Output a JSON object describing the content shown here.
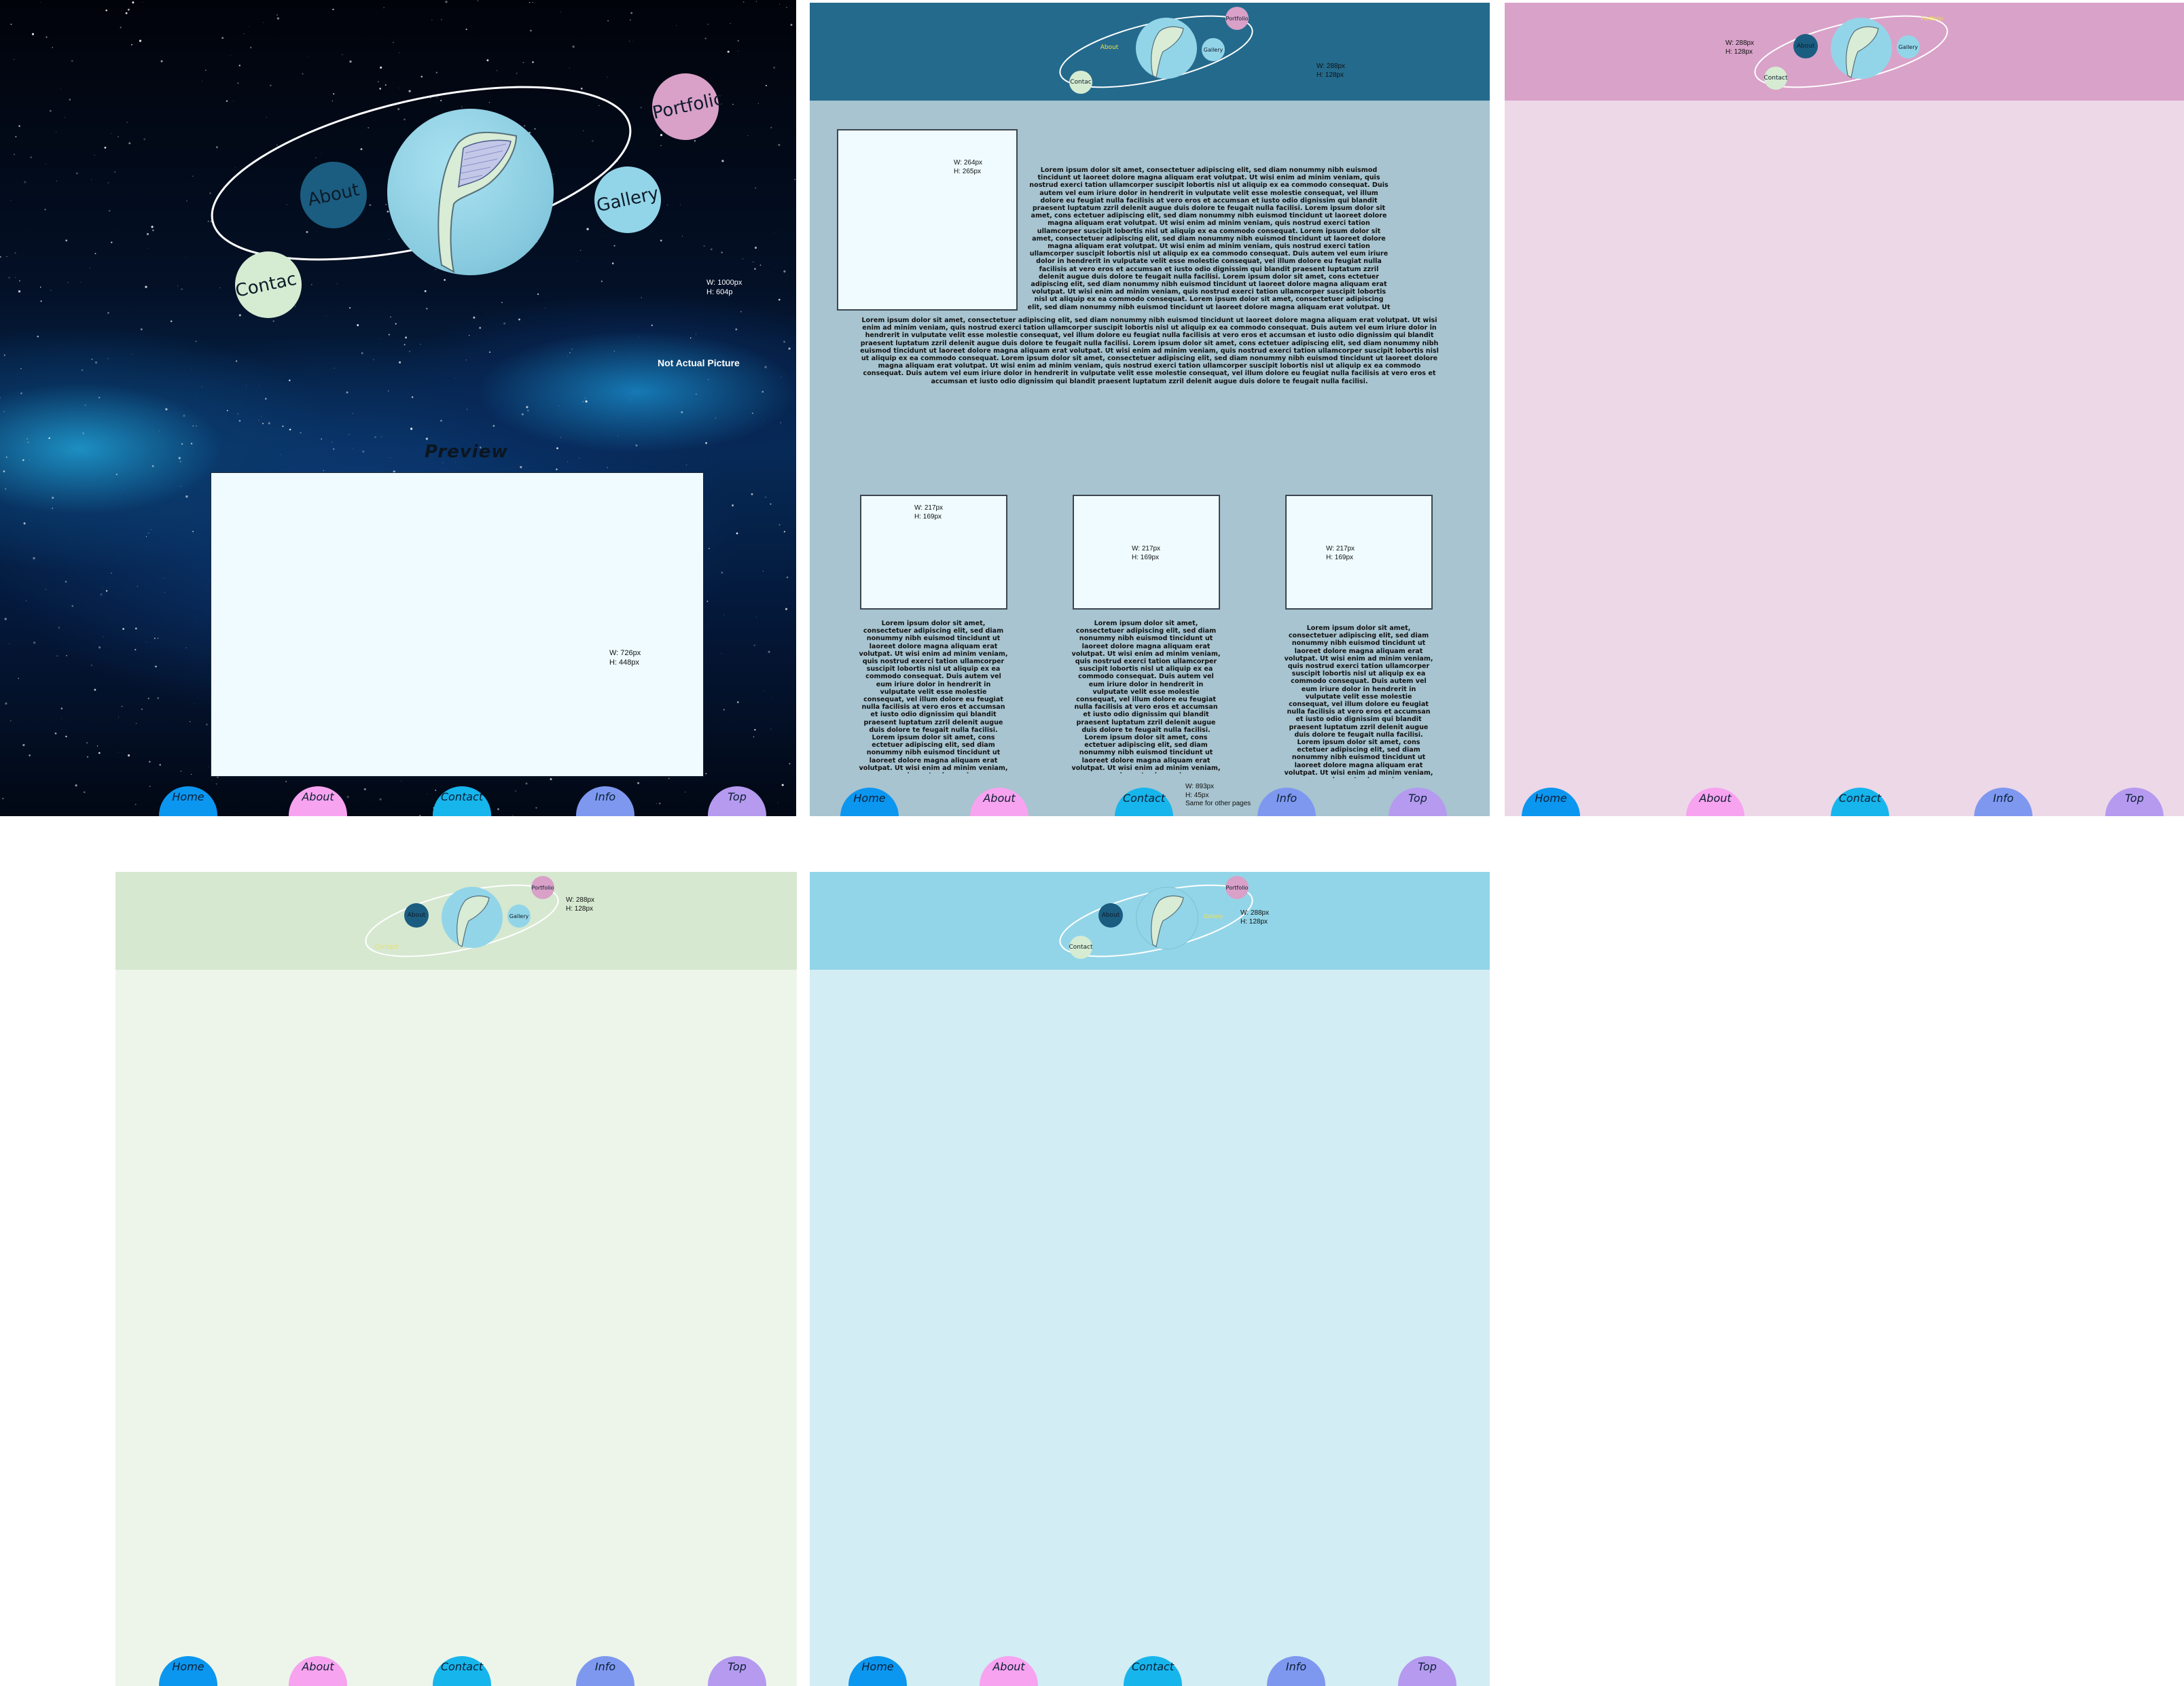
{
  "logo_labels": {
    "about": "About",
    "contact": "Contact",
    "contact_cut": "Contac",
    "portfolio": "Portfolio",
    "portfolio_cut": "Portfolic",
    "gallery": "Gallery"
  },
  "space_panel": {
    "size_note": "W: 1000px\nH: 604p",
    "not_actual": "Not Actual Picture",
    "preview_title": "Preview",
    "preview_size": "W: 726px\nH: 448px"
  },
  "teal_panel": {
    "header_size": "W: 288px\nH: 128px",
    "image_size": "W: 264px\nH: 265px",
    "lorem_main": "Lorem ipsum dolor sit amet, consectetuer adipiscing elit, sed diam nonummy nibh euismod tincidunt ut laoreet dolore magna aliquam erat volutpat. Ut wisi enim ad minim veniam, quis nostrud exerci tation ullamcorper suscipit lobortis nisl ut aliquip ex ea commodo consequat. Duis autem vel eum iriure dolor in hendrerit in vulputate velit esse molestie consequat, vel illum dolore eu feugiat nulla facilisis at vero eros et accumsan et iusto odio dignissim qui blandit praesent luptatum zzril delenit augue duis dolore te feugait nulla facilisi. Lorem ipsum dolor sit amet, cons ectetuer adipiscing elit, sed diam nonummy nibh euismod tincidunt ut laoreet dolore magna aliquam erat volutpat. Ut wisi enim ad minim veniam, quis nostrud exerci tation ullamcorper suscipit lobortis nisl ut aliquip ex ea commodo consequat. Lorem ipsum dolor sit amet, consectetuer adipiscing elit, sed diam nonummy nibh euismod tincidunt ut laoreet dolore magna aliquam erat volutpat. Ut wisi enim ad minim veniam, quis nostrud exerci tation ullamcorper suscipit lobortis nisl ut aliquip ex ea commodo consequat. Duis autem vel eum iriure dolor in hendrerit in vulputate velit esse molestie consequat, vel illum dolore eu feugiat nulla facilisis at vero eros et accumsan et iusto odio dignissim qui blandit praesent luptatum zzril delenit augue duis dolore te feugait nulla facilisi. Lorem ipsum dolor sit amet, cons ectetuer adipiscing elit, sed diam nonummy nibh euismod tincidunt ut laoreet dolore magna aliquam erat volutpat. Ut wisi enim ad minim veniam, quis nostrud exerci tation ullamcorper suscipit lobortis nisl ut aliquip ex ea commodo consequat. Lorem ipsum dolor sit amet, consectetuer adipiscing elit, sed diam nonummy nibh euismod tincidunt ut laoreet dolore magna aliquam erat volutpat. Ut wisi enim ad minim veniam, quis nostrud exerci",
    "lorem_wide": "Lorem ipsum dolor sit amet, consectetuer adipiscing elit, sed diam nonummy nibh euismod tincidunt ut laoreet dolore magna aliquam erat volutpat. Ut wisi enim ad minim veniam, quis nostrud exerci tation ullamcorper suscipit lobortis nisl ut aliquip ex ea commodo consequat. Duis autem vel eum iriure dolor in hendrerit in vulputate velit esse molestie consequat, vel illum dolore eu feugiat nulla facilisis at vero eros et accumsan et iusto odio dignissim qui blandit praesent luptatum zzril delenit augue duis dolore te feugait nulla facilisi. Lorem ipsum dolor sit amet, cons ectetuer adipiscing elit, sed diam nonummy nibh euismod tincidunt ut laoreet dolore magna aliquam erat volutpat. Ut wisi enim ad minim veniam, quis nostrud exerci tation ullamcorper suscipit lobortis nisl ut aliquip ex ea commodo consequat. Lorem ipsum dolor sit amet, consectetuer adipiscing elit, sed diam nonummy nibh euismod tincidunt ut laoreet dolore magna aliquam erat volutpat. Ut wisi enim ad minim veniam, quis nostrud exerci tation ullamcorper suscipit lobortis nisl ut aliquip ex ea commodo consequat. Duis autem vel eum iriure dolor in hendrerit in vulputate velit esse molestie consequat, vel illum dolore eu feugiat nulla facilisis at vero eros et accumsan et iusto odio dignissim qui blandit praesent luptatum zzril delenit augue duis dolore te feugait nulla facilisi.",
    "box_sizes": [
      "W: 217px\nH: 169px",
      "W: 217px\nH: 169px",
      "W: 217px\nH: 169px"
    ],
    "lorem_col": "Lorem ipsum dolor sit amet, consectetuer adipiscing elit, sed diam nonummy nibh euismod tincidunt ut laoreet dolore magna aliquam erat volutpat. Ut wisi enim ad minim veniam, quis nostrud exerci tation ullamcorper suscipit lobortis nisl ut aliquip ex ea commodo consequat. Duis autem vel eum iriure dolor in hendrerit in vulputate velit esse molestie consequat, vel illum dolore eu feugiat nulla facilisis at vero eros et accumsan et iusto odio dignissim qui blandit praesent luptatum zzril delenit augue duis dolore te feugait nulla facilisi. Lorem ipsum dolor sit amet, cons ectetuer adipiscing elit, sed diam nonummy nibh euismod tincidunt ut laoreet dolore magna aliquam erat volutpat. Ut wisi enim ad minim veniam, quis nostrud exerci",
    "nav_size_note": "W: 893px\nH: 45px\nSame for other pages"
  },
  "pink_panel": {
    "header_size": "W: 288px\nH: 128px"
  },
  "green_panel": {
    "header_size": "W: 288px\nH: 128px"
  },
  "blue_panel": {
    "header_size": "W: 288px\nH: 128px"
  },
  "nav": [
    "Home",
    "About",
    "Contact",
    "Info",
    "Top"
  ],
  "colors": {
    "home": "#0b96f0",
    "about": "#f7a3f0",
    "contact": "#16b5ec",
    "info": "#7e98f0",
    "top": "#b59af0",
    "planet_main": "#93d5e8",
    "planet_about": "#1b5d80",
    "planet_contact": "#d6ecd2",
    "planet_portfolio": "#d9a0c8",
    "planet_gallery": "#93d5e8",
    "teal_header": "#246a8c",
    "teal_body": "#a7c4d0",
    "pink_header": "#d9a2c9",
    "pink_body": "#edd8e8",
    "green_header": "#d6e8d0",
    "green_body": "#edf5ea",
    "blue_header": "#93d5e8",
    "blue_body": "#d3edf4"
  }
}
